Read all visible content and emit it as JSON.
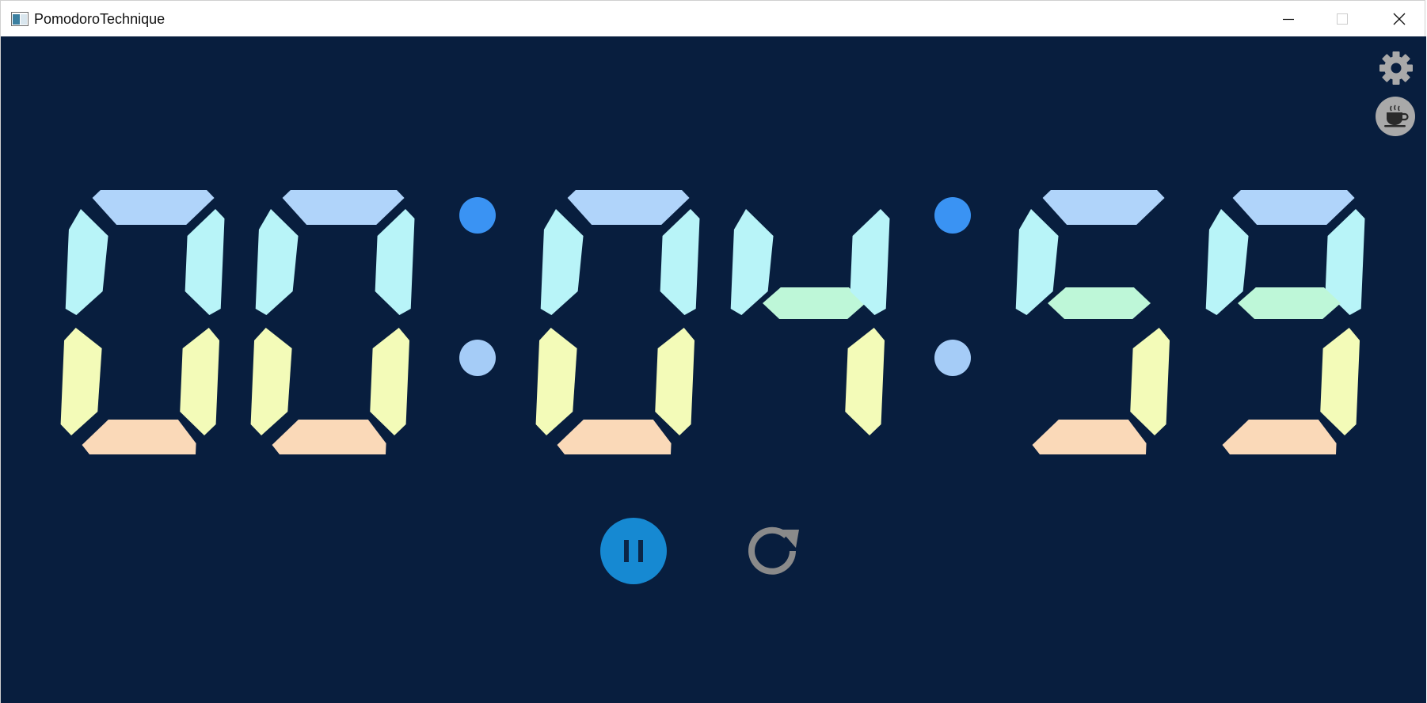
{
  "window": {
    "title": "PomodoroTechnique",
    "controls": {
      "minimize": "minimize",
      "maximize": "maximize",
      "close": "close"
    }
  },
  "timer": {
    "hours": "00",
    "minutes": "04",
    "seconds": "59",
    "digits": [
      "0",
      "0",
      "0",
      "4",
      "5",
      "9"
    ]
  },
  "icons": {
    "settings": "gear-icon",
    "break": "coffee-cup-icon",
    "pause": "pause-icon",
    "reset": "refresh-icon"
  },
  "colors": {
    "background": "#081e3e",
    "segment_top": "#b0d4fa",
    "segment_upper_sides": "#b8f4f8",
    "segment_middle": "#bef7d8",
    "segment_lower_sides": "#f3fbb8",
    "segment_bottom": "#fad9b8",
    "colon_top": "#3a93f3",
    "colon_bottom": "#a5ccf7",
    "pause_button": "#1689d2",
    "icon_gray": "#8a8a8a"
  }
}
